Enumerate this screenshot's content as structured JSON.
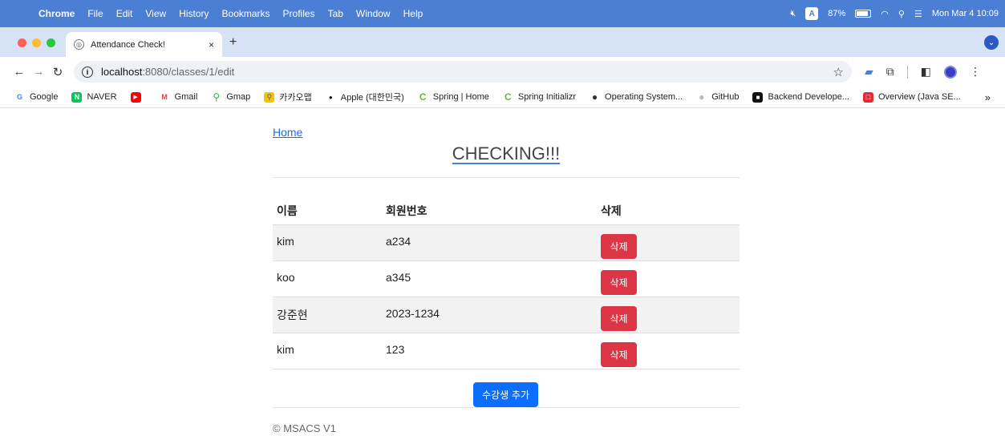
{
  "menubar": {
    "app": "Chrome",
    "items": [
      "File",
      "Edit",
      "View",
      "History",
      "Bookmarks",
      "Profiles",
      "Tab",
      "Window",
      "Help"
    ],
    "input_source": "A",
    "battery": "87%",
    "clock": "Mon Mar 4  10:09"
  },
  "tab": {
    "title": "Attendance Check!",
    "close": "×",
    "new_tab": "+"
  },
  "address": {
    "host": "localhost",
    "path": ":8080/classes/1/edit"
  },
  "bookmarks": [
    {
      "label": "Google",
      "icon": "G",
      "color": "#4285f4"
    },
    {
      "label": "NAVER",
      "icon": "N",
      "color": "#03c75a"
    },
    {
      "label": "",
      "icon": "▶",
      "color": "#ff0000"
    },
    {
      "label": "Gmail",
      "icon": "M",
      "color": "#ea4335"
    },
    {
      "label": "Gmap",
      "icon": "⚲",
      "color": "#34a853"
    },
    {
      "label": "카카오맵",
      "icon": "⚲",
      "color": "#f5c400"
    },
    {
      "label": "Apple (대한민국)",
      "icon": "●",
      "color": "#111111"
    },
    {
      "label": "Spring | Home",
      "icon": "C",
      "color": "#6db33f"
    },
    {
      "label": "Spring Initializr",
      "icon": "C",
      "color": "#6db33f"
    },
    {
      "label": "Operating System...",
      "icon": "●",
      "color": "#333333"
    },
    {
      "label": "GitHub",
      "icon": "●",
      "color": "#bbbbbb"
    },
    {
      "label": "Backend Develope...",
      "icon": "■",
      "color": "#111111"
    },
    {
      "label": "Overview (Java SE...",
      "icon": "□",
      "color": "#e32a35"
    }
  ],
  "bookmarks_more": "»",
  "page": {
    "home_link": "Home",
    "title": "CHECKING!!!",
    "table": {
      "headers": [
        "이름",
        "회원번호",
        "삭제"
      ],
      "rows": [
        {
          "name": "kim",
          "member_no": "a234",
          "delete": "삭제"
        },
        {
          "name": "koo",
          "member_no": "a345",
          "delete": "삭제"
        },
        {
          "name": "강준현",
          "member_no": "2023-1234",
          "delete": "삭제"
        },
        {
          "name": "kim",
          "member_no": "123",
          "delete": "삭제"
        }
      ]
    },
    "add_button": "수강생 추가",
    "footer": "© MSACS V1"
  },
  "colors": {
    "menubar": "#4a7fd3",
    "danger": "#dc3545",
    "primary": "#0d6efd"
  }
}
